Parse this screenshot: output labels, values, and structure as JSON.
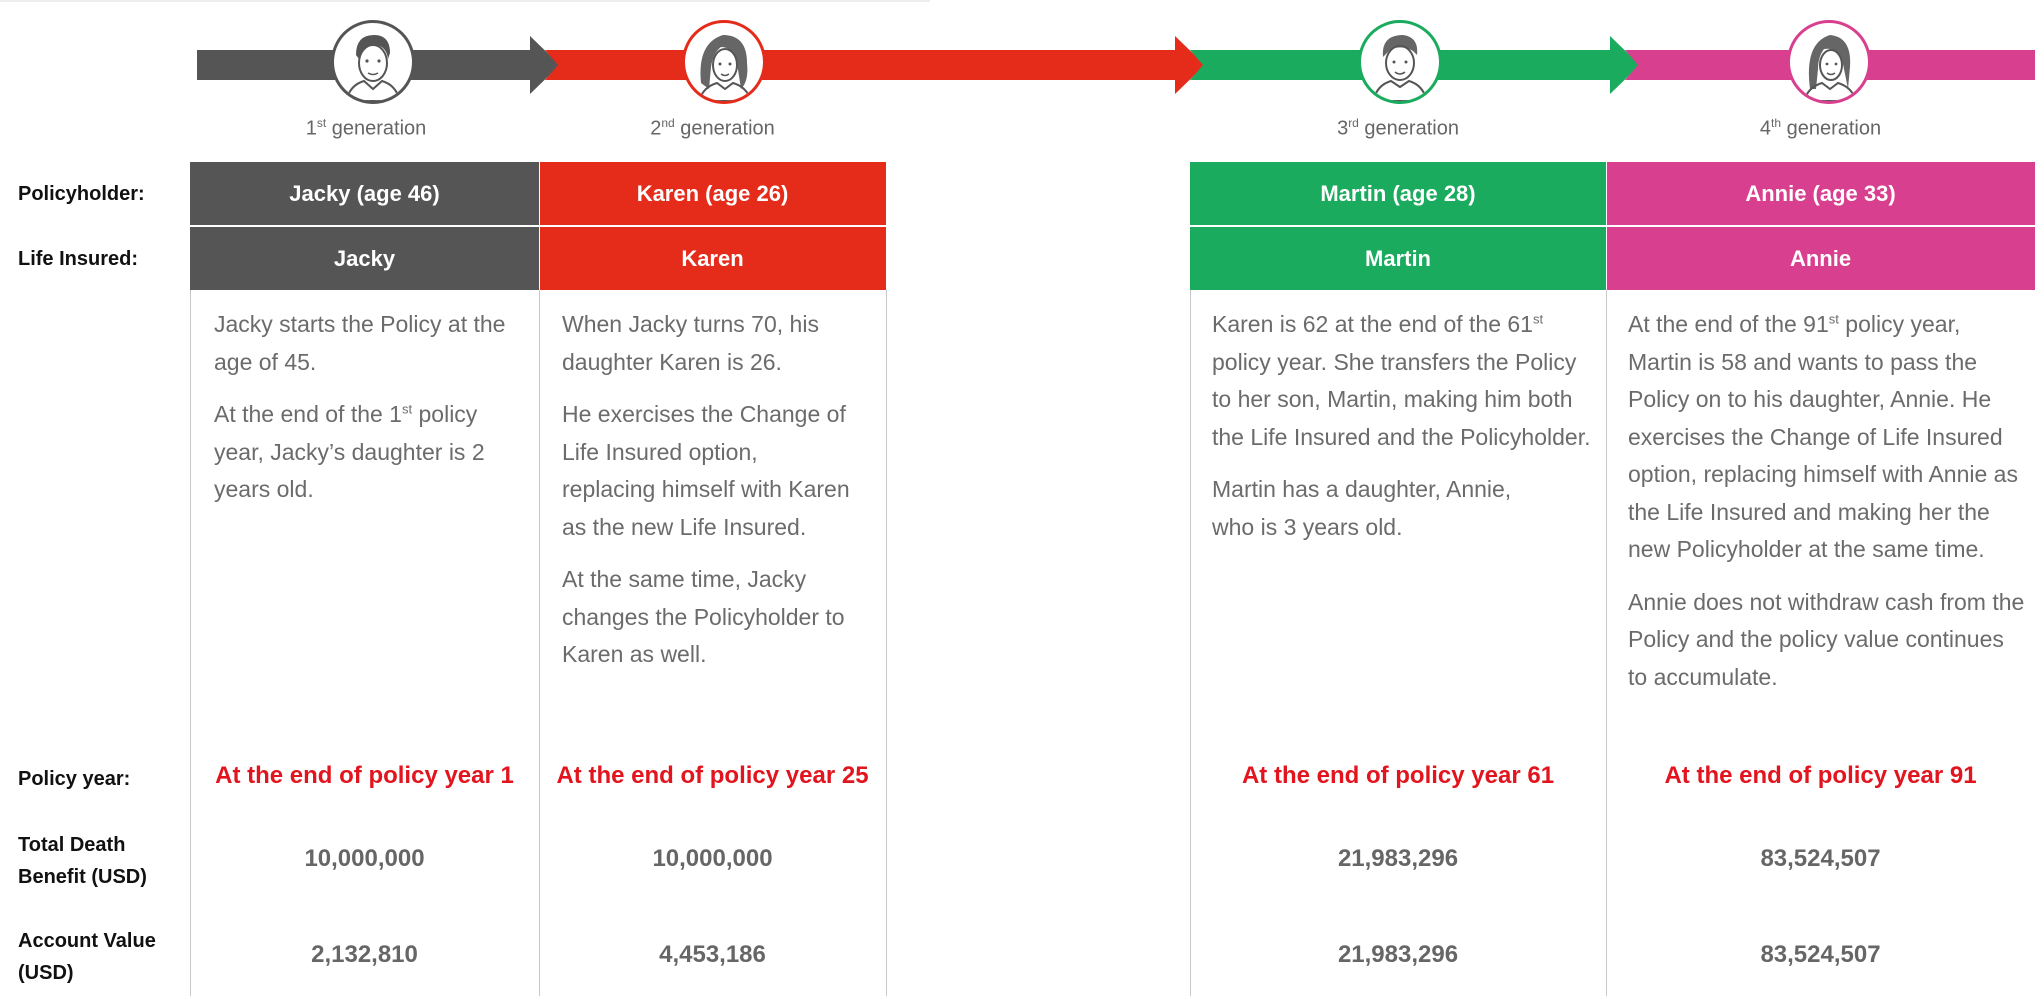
{
  "colors": {
    "gen1": "#555555",
    "gen2": "#e52b1a",
    "gen3": "#1aab5e",
    "gen4": "#d93f8f",
    "policy_year_text": "#e2141e",
    "body_text": "#6b6b6b"
  },
  "row_labels": {
    "policyholder": "Policyholder:",
    "life_insured": "Life Insured:",
    "policy_year": "Policy year:",
    "total_death_benefit": "Total Death Benefit (USD)",
    "account_value": "Account Value (USD)"
  },
  "generations": [
    {
      "ordinal": "1",
      "suffix": "st",
      "label": " generation",
      "avatar_icon": "man-avatar-icon",
      "policyholder": "Jacky (age 46)",
      "life_insured": "Jacky",
      "policy_year": "At the end of policy year 1",
      "total_death_benefit": "10,000,000",
      "account_value": "2,132,810"
    },
    {
      "ordinal": "2",
      "suffix": "nd",
      "label": " generation",
      "avatar_icon": "woman-avatar-icon",
      "policyholder": "Karen (age 26)",
      "life_insured": "Karen",
      "policy_year": "At the end of policy year 25",
      "total_death_benefit": "10,000,000",
      "account_value": "4,453,186"
    },
    {
      "ordinal": "3",
      "suffix": "rd",
      "label": " generation",
      "avatar_icon": "young-man-avatar-icon",
      "policyholder": "Martin (age 28)",
      "life_insured": "Martin",
      "policy_year": "At the end of policy year 61",
      "total_death_benefit": "21,983,296",
      "account_value": "21,983,296"
    },
    {
      "ordinal": "4",
      "suffix": "th",
      "label": " generation",
      "avatar_icon": "young-woman-avatar-icon",
      "policyholder": "Annie (age 33)",
      "life_insured": "Annie",
      "policy_year": "At the end of policy year 91",
      "total_death_benefit": "83,524,507",
      "account_value": "83,524,507"
    }
  ],
  "descriptions": {
    "gen1_p1": "Jacky starts the Policy at the age of 45.",
    "gen1_p2_a": "At the end of the 1",
    "gen1_p2_sup": "st",
    "gen1_p2_b": " policy year, Jacky’s daughter is 2 years old.",
    "gen2_p1": "When Jacky turns 70, his daughter Karen is 26.",
    "gen2_p2": "He exercises the Change of Life Insured option, replacing himself with Karen as the new Life Insured.",
    "gen2_p3": "At the same time, Jacky changes the Policyholder to Karen as well.",
    "gen3_p1_a": "Karen is 62 at the end of the 61",
    "gen3_p1_sup": "st",
    "gen3_p1_b": " policy year. She transfers the Policy to her son, Martin, making him both the Life Insured and the Policyholder.",
    "gen3_p2": "Martin has a daughter, Annie, who is 3 years old.",
    "gen4_p1_a": "At the end of the 91",
    "gen4_p1_sup": "st",
    "gen4_p1_b": " policy year, Martin is 58 and wants to pass the Policy on to his daughter, Annie. He exercises the Change of Life Insured option, replacing himself with Annie as the Life Insured and making her the new Policyholder at the same time.",
    "gen4_p2": "Annie does not withdraw cash from the Policy and the policy value continues to accumulate."
  }
}
